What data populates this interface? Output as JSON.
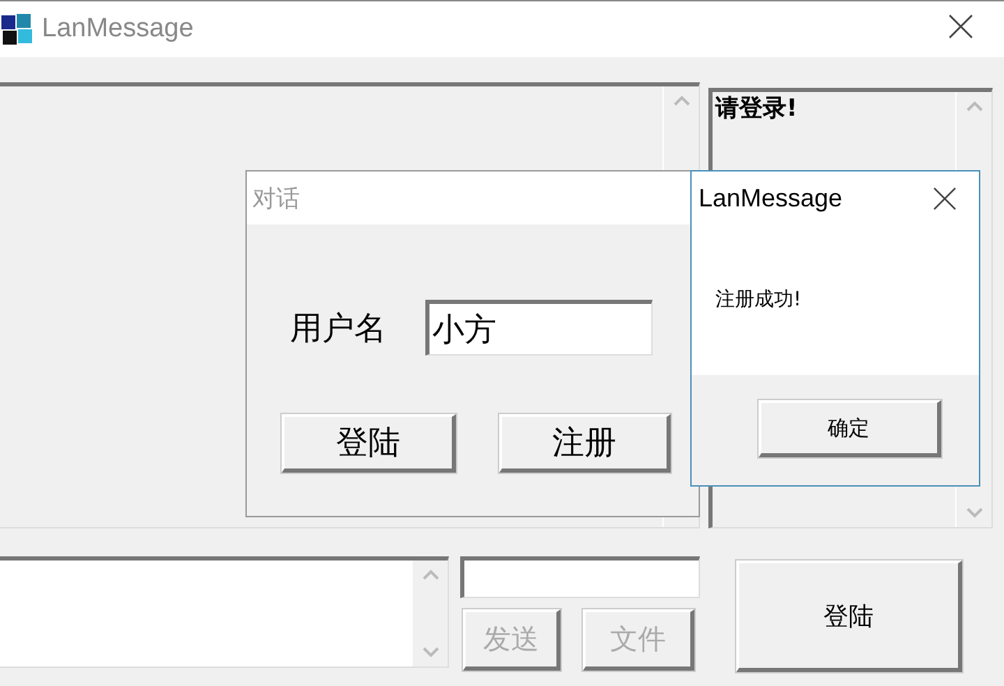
{
  "window": {
    "title": "LanMessage"
  },
  "status_list": {
    "items": [
      "请登录!"
    ]
  },
  "buttons": [
    {
      "label": "发送",
      "disabled": true
    },
    {
      "label": "文件",
      "disabled": true
    },
    {
      "label": "登陆",
      "disabled": false
    }
  ],
  "dialog": {
    "title": "对话",
    "username_label": "用户名",
    "username_value": "小方",
    "buttons": [
      {
        "label": "登陆"
      },
      {
        "label": "注册"
      }
    ]
  },
  "message_box": {
    "title": "LanMessage",
    "text": "注册成功!",
    "button": "确定"
  }
}
